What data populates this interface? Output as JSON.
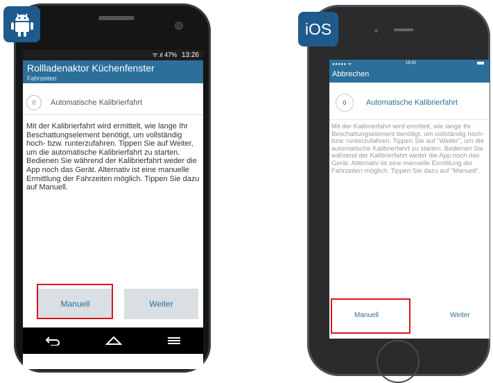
{
  "badges": {
    "android_icon": "android-robot-icon",
    "ios_label": "iOS"
  },
  "android": {
    "status": {
      "signal": "ᯤ.ıl 47%",
      "time": "13:26"
    },
    "appbar": {
      "title": "Rollladenaktor Küchenfenster",
      "subtitle": "Fahrzeiten"
    },
    "step": {
      "number": "0",
      "label": "Automatische Kalibrierfahrt"
    },
    "body": "Mit der Kalibrierfahrt wird ermittelt, wie lange Ihr Beschattungselement benötigt, um vollständig hoch- bzw. runterzufahren. Tippen Sie auf Weiter, um die automatische Kalibrierfahrt zu starten. Bedienen Sie während der Kalibrierfahrt weder die App noch das Gerät. Alternativ ist eine manuelle Ermittlung der Fahrzeiten möglich. Tippen Sie dazu auf Manuell.",
    "buttons": {
      "manuell": "Manuell",
      "weiter": "Weiter"
    },
    "navbar": [
      "back-icon",
      "home-icon",
      "menu-icon"
    ]
  },
  "ios": {
    "status": {
      "carrier": "●●●●● ᯤ",
      "time": "16:30"
    },
    "header": {
      "cancel": "Abbrechen"
    },
    "step": {
      "number": "0",
      "label": "Automatische Kalibrierfahrt"
    },
    "body": "Mit der Kalibrierfahrt wird ermittelt, wie lange Ihr Beschattungselement benötigt, um vollständig hoch- bzw. runterzufahren. Tippen Sie auf \"Weiter\", um die automatische Kalibrierfahrt zu starten. Bedienen Sie während der Kalibrierfahrt weder die App noch das Gerät. Alternativ ist eine manuelle Ermittlung der Fahrzeiten möglich. Tippen Sie dazu auf \"Manuell\".",
    "buttons": {
      "manuell": "Manuell",
      "weiter": "Weiter"
    }
  },
  "colors": {
    "brand": "#2b6f9a",
    "badge": "#1e5a8b",
    "highlight": "#d9141c"
  }
}
